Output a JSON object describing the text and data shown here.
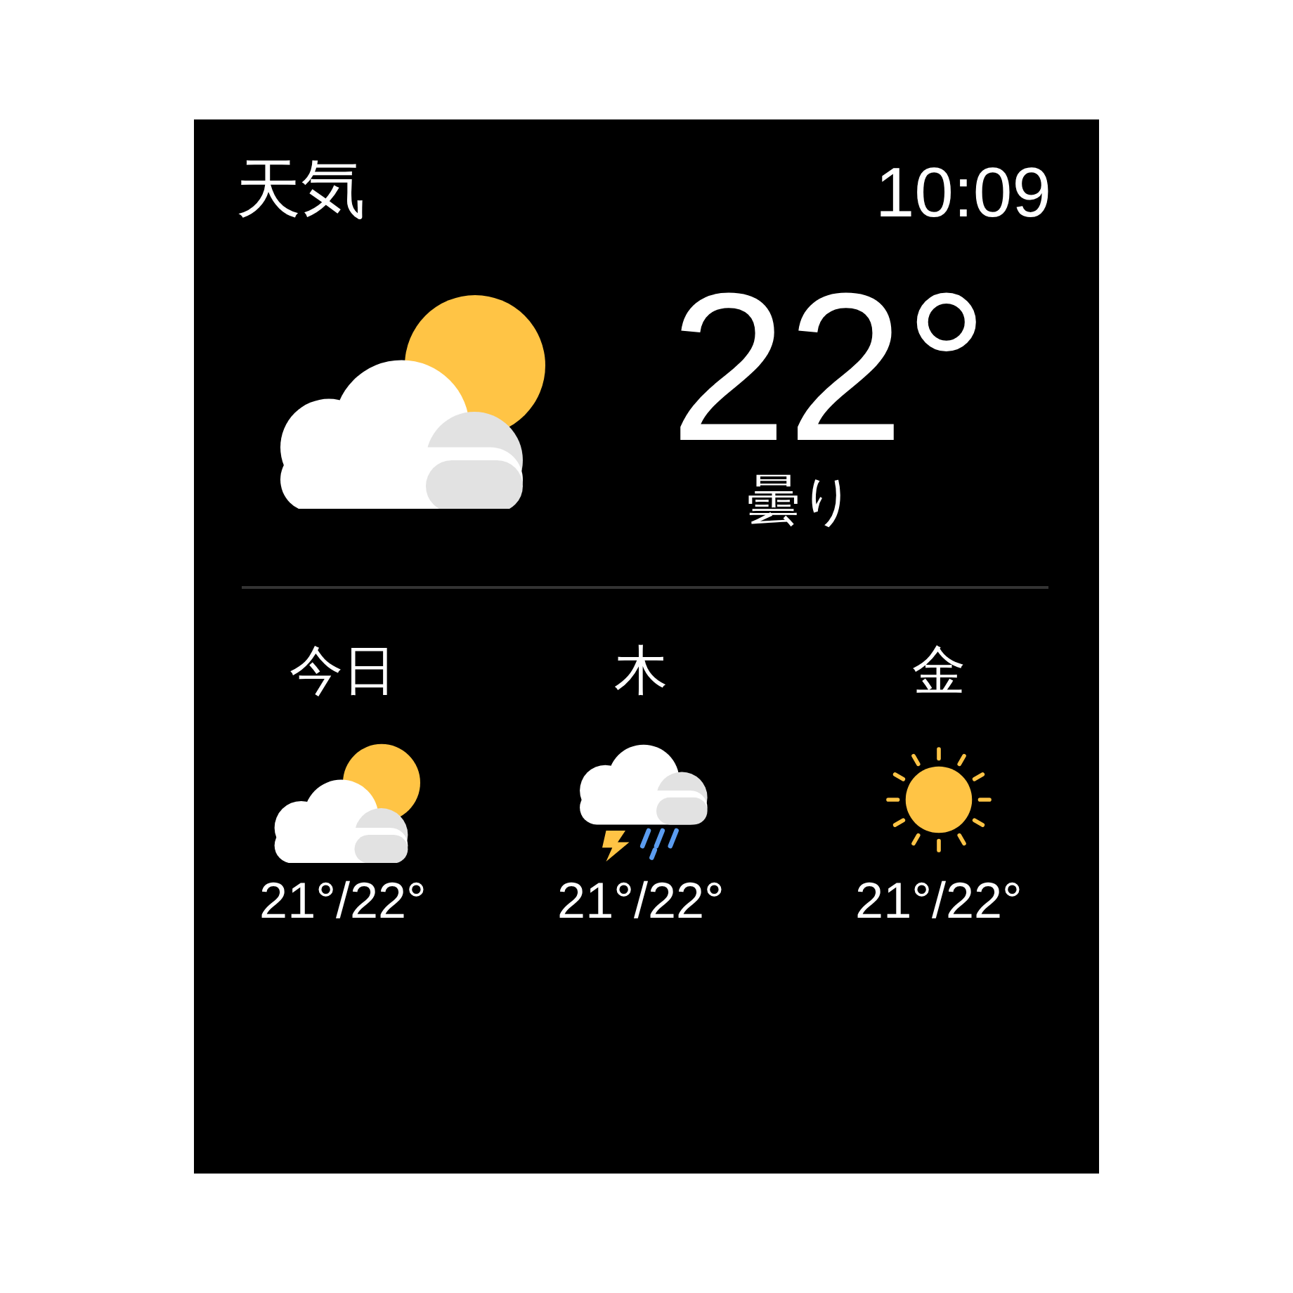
{
  "header": {
    "title": "天気",
    "time": "10:09"
  },
  "current": {
    "temperature": "22°",
    "condition": "曇り",
    "kind": "partly-cloudy"
  },
  "forecast": [
    {
      "day": "今日",
      "kind": "partly-cloudy",
      "temps": "21°/22°"
    },
    {
      "day": "木",
      "kind": "thunderstorm",
      "temps": "21°/22°"
    },
    {
      "day": "金",
      "kind": "sunny",
      "temps": "21°/22°"
    }
  ]
}
